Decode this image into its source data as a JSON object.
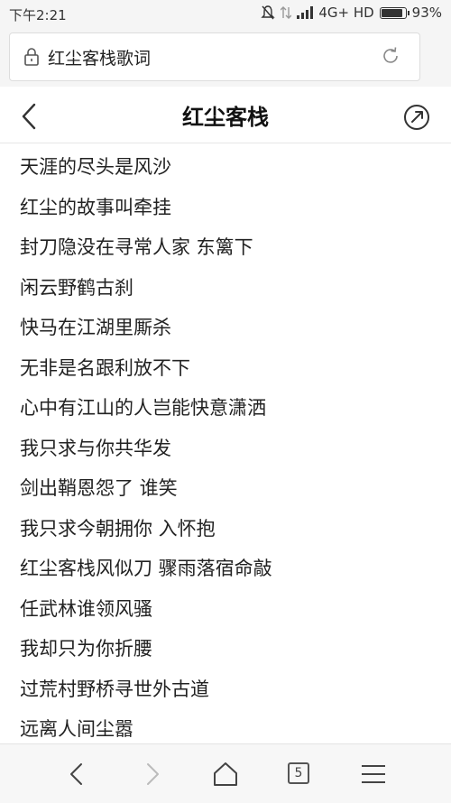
{
  "status_bar": {
    "time": "下午2:21",
    "network": "4G+ HD",
    "battery": "93%",
    "battery_level": 0.93,
    "icons": [
      "mute-icon",
      "transfer-icon",
      "signal-icon",
      "battery-icon"
    ]
  },
  "browser": {
    "url": "红尘客栈歌词",
    "icons": [
      "lock-icon",
      "refresh-icon"
    ]
  },
  "page": {
    "title": "红尘客栈",
    "icons": [
      "back-icon",
      "share-icon"
    ]
  },
  "lyrics": [
    "天涯的尽头是风沙",
    "红尘的故事叫牵挂",
    "封刀隐没在寻常人家 东篱下",
    "闲云野鹤古刹",
    "快马在江湖里厮杀",
    "无非是名跟利放不下",
    "心中有江山的人岂能快意潇洒",
    "我只求与你共华发",
    "剑出鞘恩怨了 谁笑",
    "我只求今朝拥你 入怀抱",
    "红尘客栈风似刀 骤雨落宿命敲",
    "任武林谁领风骚",
    "我却只为你折腰",
    "过荒村野桥寻世外古道",
    "远离人间尘嚣"
  ],
  "bottom_bar": {
    "tab_count": "5",
    "icons": [
      "back-arrow-icon",
      "forward-arrow-icon",
      "home-icon",
      "tabs-icon",
      "menu-icon"
    ]
  }
}
